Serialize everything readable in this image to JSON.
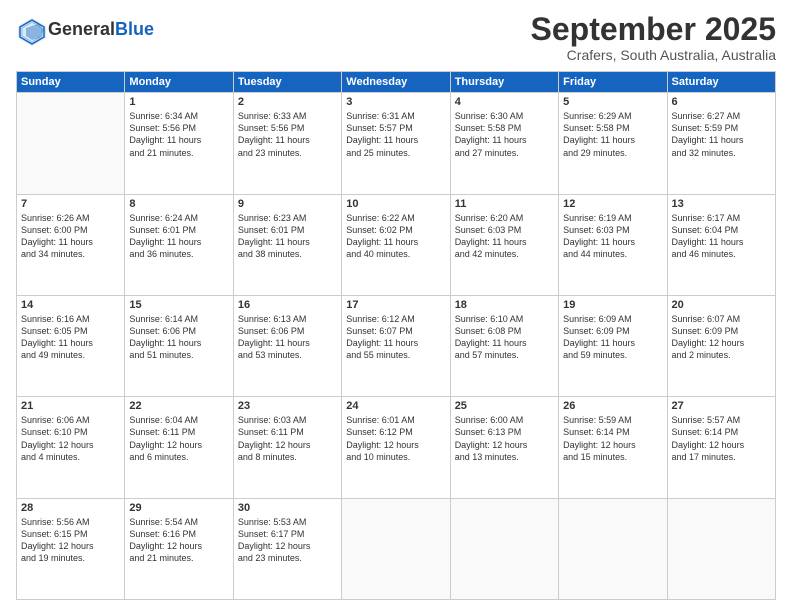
{
  "header": {
    "logo_line1": "General",
    "logo_line2": "Blue",
    "month": "September 2025",
    "location": "Crafers, South Australia, Australia"
  },
  "days_of_week": [
    "Sunday",
    "Monday",
    "Tuesday",
    "Wednesday",
    "Thursday",
    "Friday",
    "Saturday"
  ],
  "weeks": [
    [
      {
        "day": "",
        "info": ""
      },
      {
        "day": "1",
        "info": "Sunrise: 6:34 AM\nSunset: 5:56 PM\nDaylight: 11 hours\nand 21 minutes."
      },
      {
        "day": "2",
        "info": "Sunrise: 6:33 AM\nSunset: 5:56 PM\nDaylight: 11 hours\nand 23 minutes."
      },
      {
        "day": "3",
        "info": "Sunrise: 6:31 AM\nSunset: 5:57 PM\nDaylight: 11 hours\nand 25 minutes."
      },
      {
        "day": "4",
        "info": "Sunrise: 6:30 AM\nSunset: 5:58 PM\nDaylight: 11 hours\nand 27 minutes."
      },
      {
        "day": "5",
        "info": "Sunrise: 6:29 AM\nSunset: 5:58 PM\nDaylight: 11 hours\nand 29 minutes."
      },
      {
        "day": "6",
        "info": "Sunrise: 6:27 AM\nSunset: 5:59 PM\nDaylight: 11 hours\nand 32 minutes."
      }
    ],
    [
      {
        "day": "7",
        "info": "Sunrise: 6:26 AM\nSunset: 6:00 PM\nDaylight: 11 hours\nand 34 minutes."
      },
      {
        "day": "8",
        "info": "Sunrise: 6:24 AM\nSunset: 6:01 PM\nDaylight: 11 hours\nand 36 minutes."
      },
      {
        "day": "9",
        "info": "Sunrise: 6:23 AM\nSunset: 6:01 PM\nDaylight: 11 hours\nand 38 minutes."
      },
      {
        "day": "10",
        "info": "Sunrise: 6:22 AM\nSunset: 6:02 PM\nDaylight: 11 hours\nand 40 minutes."
      },
      {
        "day": "11",
        "info": "Sunrise: 6:20 AM\nSunset: 6:03 PM\nDaylight: 11 hours\nand 42 minutes."
      },
      {
        "day": "12",
        "info": "Sunrise: 6:19 AM\nSunset: 6:03 PM\nDaylight: 11 hours\nand 44 minutes."
      },
      {
        "day": "13",
        "info": "Sunrise: 6:17 AM\nSunset: 6:04 PM\nDaylight: 11 hours\nand 46 minutes."
      }
    ],
    [
      {
        "day": "14",
        "info": "Sunrise: 6:16 AM\nSunset: 6:05 PM\nDaylight: 11 hours\nand 49 minutes."
      },
      {
        "day": "15",
        "info": "Sunrise: 6:14 AM\nSunset: 6:06 PM\nDaylight: 11 hours\nand 51 minutes."
      },
      {
        "day": "16",
        "info": "Sunrise: 6:13 AM\nSunset: 6:06 PM\nDaylight: 11 hours\nand 53 minutes."
      },
      {
        "day": "17",
        "info": "Sunrise: 6:12 AM\nSunset: 6:07 PM\nDaylight: 11 hours\nand 55 minutes."
      },
      {
        "day": "18",
        "info": "Sunrise: 6:10 AM\nSunset: 6:08 PM\nDaylight: 11 hours\nand 57 minutes."
      },
      {
        "day": "19",
        "info": "Sunrise: 6:09 AM\nSunset: 6:09 PM\nDaylight: 11 hours\nand 59 minutes."
      },
      {
        "day": "20",
        "info": "Sunrise: 6:07 AM\nSunset: 6:09 PM\nDaylight: 12 hours\nand 2 minutes."
      }
    ],
    [
      {
        "day": "21",
        "info": "Sunrise: 6:06 AM\nSunset: 6:10 PM\nDaylight: 12 hours\nand 4 minutes."
      },
      {
        "day": "22",
        "info": "Sunrise: 6:04 AM\nSunset: 6:11 PM\nDaylight: 12 hours\nand 6 minutes."
      },
      {
        "day": "23",
        "info": "Sunrise: 6:03 AM\nSunset: 6:11 PM\nDaylight: 12 hours\nand 8 minutes."
      },
      {
        "day": "24",
        "info": "Sunrise: 6:01 AM\nSunset: 6:12 PM\nDaylight: 12 hours\nand 10 minutes."
      },
      {
        "day": "25",
        "info": "Sunrise: 6:00 AM\nSunset: 6:13 PM\nDaylight: 12 hours\nand 13 minutes."
      },
      {
        "day": "26",
        "info": "Sunrise: 5:59 AM\nSunset: 6:14 PM\nDaylight: 12 hours\nand 15 minutes."
      },
      {
        "day": "27",
        "info": "Sunrise: 5:57 AM\nSunset: 6:14 PM\nDaylight: 12 hours\nand 17 minutes."
      }
    ],
    [
      {
        "day": "28",
        "info": "Sunrise: 5:56 AM\nSunset: 6:15 PM\nDaylight: 12 hours\nand 19 minutes."
      },
      {
        "day": "29",
        "info": "Sunrise: 5:54 AM\nSunset: 6:16 PM\nDaylight: 12 hours\nand 21 minutes."
      },
      {
        "day": "30",
        "info": "Sunrise: 5:53 AM\nSunset: 6:17 PM\nDaylight: 12 hours\nand 23 minutes."
      },
      {
        "day": "",
        "info": ""
      },
      {
        "day": "",
        "info": ""
      },
      {
        "day": "",
        "info": ""
      },
      {
        "day": "",
        "info": ""
      }
    ]
  ]
}
